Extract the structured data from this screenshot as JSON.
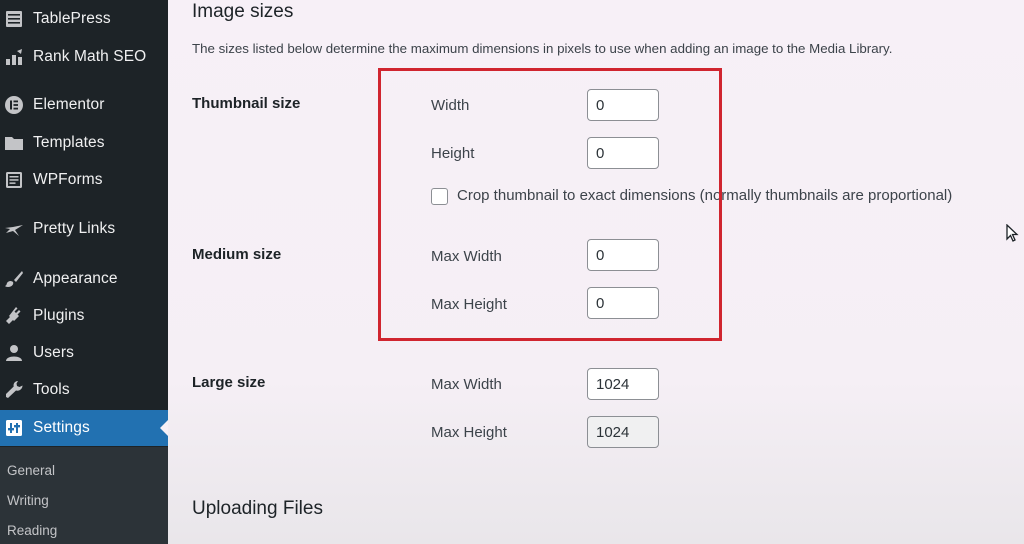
{
  "sidebar": {
    "items": [
      {
        "label": "TablePress",
        "icon": "table-icon"
      },
      {
        "label": "Rank Math SEO",
        "icon": "rank-math-icon"
      },
      {
        "label": "Elementor",
        "icon": "elementor-icon"
      },
      {
        "label": "Templates",
        "icon": "folder-icon"
      },
      {
        "label": "WPForms",
        "icon": "wpforms-icon"
      },
      {
        "label": "Pretty Links",
        "icon": "star-icon"
      },
      {
        "label": "Appearance",
        "icon": "brush-icon"
      },
      {
        "label": "Plugins",
        "icon": "plug-icon"
      },
      {
        "label": "Users",
        "icon": "user-icon"
      },
      {
        "label": "Tools",
        "icon": "wrench-icon"
      },
      {
        "label": "Settings",
        "icon": "settings-icon",
        "active": true
      }
    ],
    "submenu": [
      "General",
      "Writing",
      "Reading"
    ]
  },
  "main": {
    "image_sizes_heading": "Image sizes",
    "description": "The sizes listed below determine the maximum dimensions in pixels to use when adding an image to the Media Library.",
    "thumbnail": {
      "label": "Thumbnail size",
      "width_label": "Width",
      "width_value": "0",
      "height_label": "Height",
      "height_value": "0",
      "crop_label": "Crop thumbnail to exact dimensions (normally thumbnails are proportional)"
    },
    "medium": {
      "label": "Medium size",
      "max_width_label": "Max Width",
      "max_width_value": "0",
      "max_height_label": "Max Height",
      "max_height_value": "0"
    },
    "large": {
      "label": "Large size",
      "max_width_label": "Max Width",
      "max_width_value": "1024",
      "max_height_label": "Max Height",
      "max_height_value": "1024"
    },
    "uploading_heading": "Uploading Files"
  },
  "colors": {
    "sidebar_bg": "#1d2327",
    "active_bg": "#2271b1",
    "highlight": "#d0252f"
  }
}
